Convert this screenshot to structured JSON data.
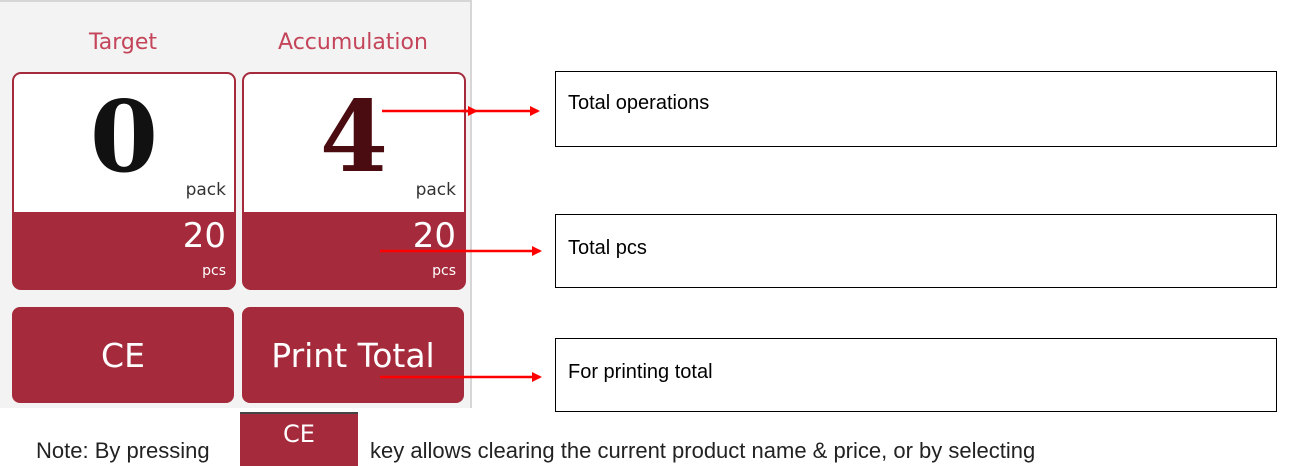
{
  "headers": {
    "target": "Target",
    "accumulation": "Accumulation"
  },
  "target_card": {
    "value": "0",
    "unit": "pack",
    "pcs_value": "20",
    "pcs_unit": "pcs"
  },
  "accumulation_card": {
    "value": "4",
    "unit": "pack",
    "pcs_value": "20",
    "pcs_unit": "pcs"
  },
  "buttons": {
    "ce": "CE",
    "print_total": "Print Total"
  },
  "callouts": {
    "total_operations": "Total operations",
    "total_pcs": "Total pcs",
    "printing_total": "For printing total"
  },
  "note": {
    "prefix": "Note: By pressing",
    "key_label": "CE",
    "suffix": "key allows clearing the current product name & price, or by selecting"
  },
  "colors": {
    "accent": "#a52a3b",
    "header_text": "#c4455a",
    "arrow": "#ff0000"
  }
}
